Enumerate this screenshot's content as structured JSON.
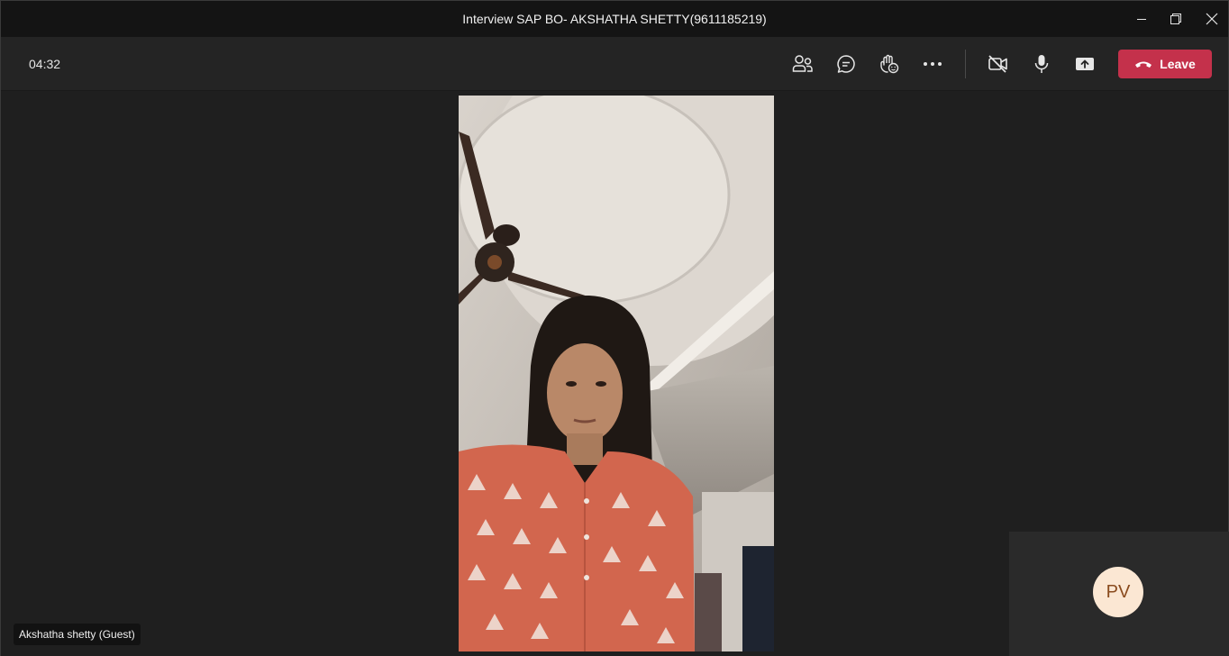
{
  "window": {
    "title": "Interview SAP BO- AKSHATHA SHETTY(9611185219)"
  },
  "toolbar": {
    "timer": "04:32",
    "icons": [
      "people-icon",
      "chat-icon",
      "raise-hand-icon",
      "more-icon",
      "camera-off-icon",
      "microphone-icon",
      "share-screen-icon"
    ],
    "leave_label": "Leave",
    "leave_color": "#c4314b"
  },
  "stage": {
    "participant_name": "Akshatha shetty (Guest)",
    "self_initials": "PV",
    "self_avatar_color": "#fbe7d3"
  }
}
